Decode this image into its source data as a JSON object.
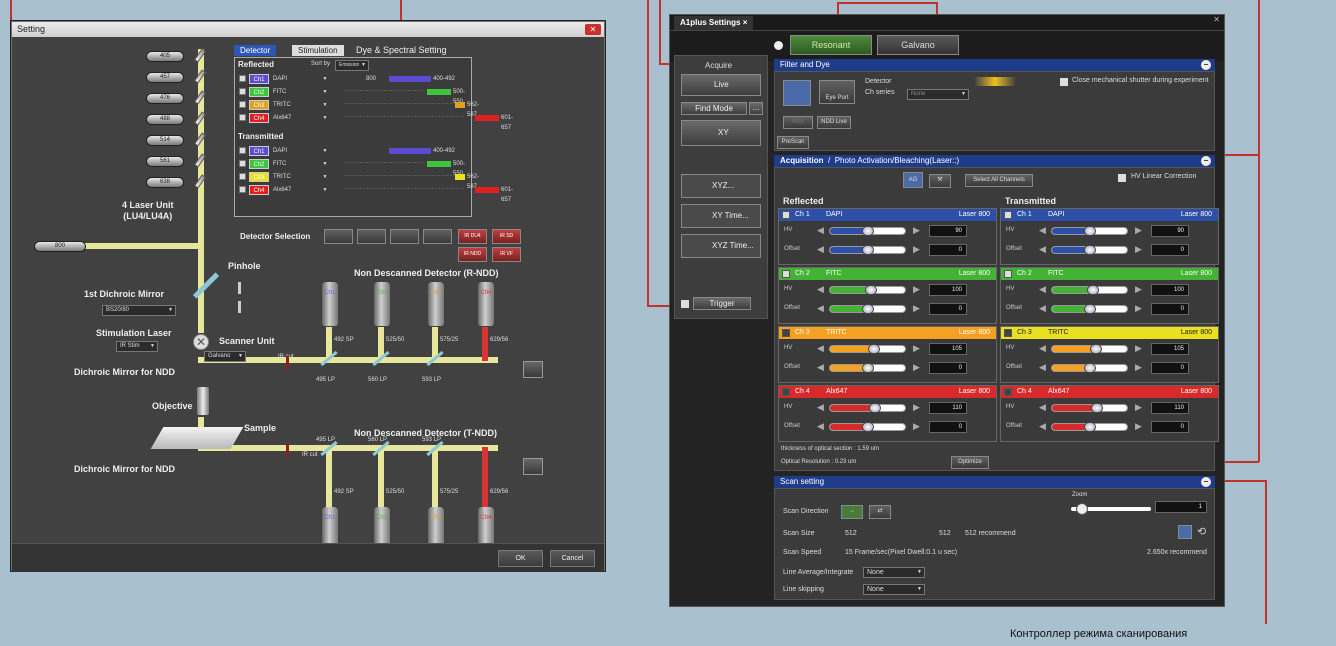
{
  "callout_label": "Контроллер режима сканирования",
  "setting": {
    "title": "Setting",
    "tabs": [
      "Detector",
      "Stimulation",
      "Dye & Spectral Setting"
    ],
    "lasers": [
      "405",
      "457",
      "476",
      "488",
      "514",
      "561",
      "638"
    ],
    "main_laser": "800",
    "laser_unit": "4 Laser Unit\n(LU4/LU4A)",
    "reflected_title": "Reflected",
    "transmitted_title": "Transmitted",
    "sort_by": "Sort by",
    "sort_value": "Emission",
    "reflected_value": "800",
    "reflected": [
      {
        "ch": "Ch1",
        "dye": "DAPI",
        "range": "400-492",
        "color": "#5a4bd0"
      },
      {
        "ch": "Ch2",
        "dye": "FITC",
        "range": "500-550",
        "color": "#3ec43e"
      },
      {
        "ch": "Ch3",
        "dye": "TRITC",
        "range": "562-587",
        "color": "#e0a020"
      },
      {
        "ch": "Ch4",
        "dye": "Alx647",
        "range": "601-657",
        "color": "#e02020"
      }
    ],
    "transmitted": [
      {
        "ch": "Ch1",
        "dye": "DAPI",
        "range": "400-492",
        "color": "#5a4bd0"
      },
      {
        "ch": "Ch2",
        "dye": "FITC",
        "range": "500-550",
        "color": "#3ec43e"
      },
      {
        "ch": "Ch3",
        "dye": "TRITC",
        "range": "562-587",
        "color": "#e8e020"
      },
      {
        "ch": "Ch4",
        "dye": "Alx647",
        "range": "601-657",
        "color": "#e02020"
      }
    ],
    "detector_selection": "Detector Selection",
    "det_buttons": [
      "",
      "",
      "",
      "",
      "IR DU4",
      "IR SD",
      "IR NDD",
      "IR VF"
    ],
    "pinhole": "Pinhole",
    "dichroic1": "1st Dichroic Mirror",
    "dichroic1_value": "BS20/80",
    "stim_laser": "Stimulation Laser",
    "stim_value": "IR Stim",
    "scanner_unit": "Scanner Unit",
    "scanner_value": "Galvano",
    "ndd_r": "Non Descanned Detector (R-NDD)",
    "ndd_t": "Non Descanned Detector (T-NDD)",
    "dichroic_ndd_1": "Dichroic Mirror for NDD",
    "dichroic_ndd_2": "Dichroic Mirror for NDD",
    "objective": "Objective",
    "sample": "Sample",
    "ir_cut": "IR cut",
    "r_filters_em": [
      "492 SP",
      "525/50",
      "575/25",
      "629/56"
    ],
    "r_filters_dm": [
      "495 LP",
      "560 LP",
      "593 LP"
    ],
    "t_filters_dm": [
      "495 LP",
      "560 LP",
      "593 LP"
    ],
    "t_filters_em": [
      "492 SP",
      "525/50",
      "575/25",
      "629/56"
    ],
    "det_channels": [
      "Ch1",
      "Ch2",
      "Ch3",
      "Ch4"
    ],
    "ok": "OK",
    "cancel": "Cancel"
  },
  "a1": {
    "title": "A1plus Settings",
    "tab_close": "×",
    "resonant": "Resonant",
    "galvano": "Galvano",
    "acquire": "Acquire",
    "live": "Live",
    "find_mode": "Find Mode",
    "ellipsis": "...",
    "xy": "XY",
    "xyz": "XYZ...",
    "xy_time": "XY Time...",
    "xyz_time": "XYZ Time...",
    "trigger": "Trigger",
    "filter_dye": "Filter and Dye",
    "eye_port": "Eye Port",
    "detector": "Detector",
    "ch_series": "Ch series",
    "ch_series_value": "None",
    "close_shutter": "Close mechanical shutter during experiment",
    "aux": "AUX",
    "ndd_live": "NDD Live",
    "prescan": "PreScan",
    "acquisition": "Acquisition",
    "photo_activation": "Photo Activation/Bleaching(Laser::)",
    "ag": "AG",
    "select_all": "Select All Channels",
    "hv_linear": "HV Linear Correction",
    "reflected": "Reflected",
    "transmitted": "Transmitted",
    "hv_label": "HV",
    "offset_label": "Offset",
    "channels": [
      {
        "ch": "Ch 1",
        "dye": "DAPI",
        "laser": "Laser 800",
        "color": "#2e4fa8",
        "hv": "90",
        "offset": "0",
        "hv_frac": 0.5,
        "off_frac": 0.5,
        "checked": true
      },
      {
        "ch": "Ch 2",
        "dye": "FITC",
        "laser": "Laser 800",
        "color": "#44b235",
        "hv": "100",
        "offset": "0",
        "hv_frac": 0.55,
        "off_frac": 0.5,
        "checked": true
      },
      {
        "ch": "Ch 3",
        "dye": "TRITC",
        "laser": "Laser 800",
        "color": "#f5a020",
        "hv": "105",
        "offset": "0",
        "hv_frac": 0.58,
        "off_frac": 0.5,
        "checked": false
      },
      {
        "ch": "Ch 4",
        "dye": "Alx647",
        "laser": "Laser 800",
        "color": "#d82a2a",
        "hv": "110",
        "offset": "0",
        "hv_frac": 0.6,
        "off_frac": 0.5,
        "checked": false
      }
    ],
    "transmitted_colors": [
      "#2e4fa8",
      "#44b235",
      "#e8e020",
      "#d82a2a"
    ],
    "thickness": "thickness of optical section : 1.59 um",
    "optical_res": "Optical Resolution : 0.23 um",
    "optimize": "Optimize",
    "scan_setting": "Scan setting",
    "zoom": "Zoom",
    "zoom_value": "1",
    "scan_direction": "Scan Direction",
    "scan_size": "Scan Size",
    "size_x": "512",
    "size_y": "512",
    "size_recommend": "512 recommend",
    "scan_speed": "Scan Speed",
    "speed_value": "15 Frame/sec(Pixel Dwell:0.1 u sec)",
    "speed_recommend": "2.650x recommend",
    "line_avg": "Line Average/Integrate",
    "line_avg_value": "None",
    "line_skip": "Line skipping",
    "line_skip_value": "None"
  }
}
